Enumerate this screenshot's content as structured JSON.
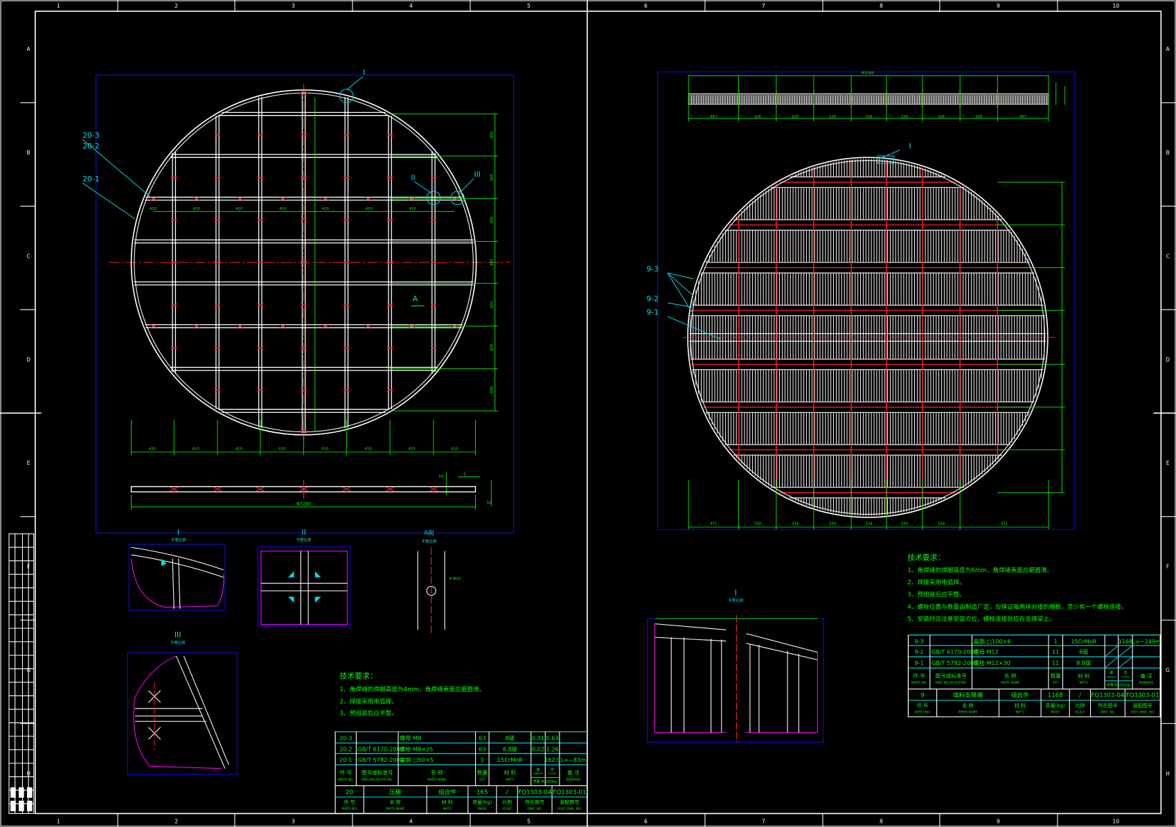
{
  "ruler": {
    "columns": [
      "1",
      "2",
      "3",
      "4",
      "5",
      "6",
      "7",
      "8",
      "9",
      "10"
    ],
    "rows": [
      "A",
      "B",
      "C",
      "D",
      "E",
      "F",
      "G",
      "H"
    ]
  },
  "left_view": {
    "callouts": {
      "I": "I",
      "II": "II",
      "III": "III",
      "p20_3": "20-3",
      "p20_2": "20-2",
      "p20_1": "20-1",
      "arrow_a": "A"
    },
    "dim_horizontal": [
      "410",
      "410",
      "410",
      "410",
      "410",
      "410",
      "410",
      "410"
    ],
    "dim_vertical": [
      "400",
      "400",
      "400",
      "400",
      "400",
      "400",
      "400"
    ],
    "overall_dim": "Φ3280",
    "strip_dims": [
      "5",
      "50",
      "50"
    ],
    "detail_labels": {
      "d1": "I",
      "d2": "II",
      "d3": "A向",
      "d4": "III",
      "scale_note": "不等比例",
      "bolt_note": "4-Φ10"
    }
  },
  "right_view": {
    "callouts": {
      "I": "I",
      "p9_3": "9-3",
      "p9_2": "9-2",
      "p9_1": "9-1"
    },
    "top_dim": "Φ3280",
    "strip_dims": [
      "467",
      "326",
      "326",
      "326",
      "326",
      "326",
      "326",
      "326",
      "467"
    ],
    "bottom_dims": [
      "471",
      "334",
      "334",
      "334",
      "334",
      "334",
      "334",
      "471"
    ],
    "detail_label": "I",
    "scale_note": "不等比例"
  },
  "left_notes": {
    "title": "技术要求：",
    "items": [
      "1、角焊缝的焊脚高度为4mm，角焊缝表面应磨圆滑。",
      "2、焊接采用电弧焊。",
      "3、预组装后应平整。"
    ]
  },
  "right_notes": {
    "title": "技术要求：",
    "items": [
      "1、角焊缝的焊脚高度为6mm，角焊缝表面应磨圆滑。",
      "2、焊接采用电弧焊。",
      "3、预组装后应平整。",
      "4、螺栓位置与数量由制造厂定，应保证每两块对接的栅板，至少有一个螺栓连接。",
      "5、安装时应注意安装方位，螺栓连接处应在支撑梁上。"
    ]
  },
  "left_table": {
    "rows": [
      [
        "20-3",
        "",
        "螺母 M8",
        "63",
        "8级",
        "0.01",
        "0.63",
        ""
      ],
      [
        "20-2",
        "GB/T 6170-2000",
        "螺栓 M8×25",
        "63",
        "8.8级",
        "0.02",
        "1.26",
        ""
      ],
      [
        "20-1",
        "GB/T 5782-2000",
        "扁钢 □50×5",
        "1",
        "15CrMoR",
        "",
        "162.9",
        "L=~83m"
      ]
    ],
    "header": [
      "件 号",
      "图号或标准号",
      "名 称",
      "数量",
      "材 料",
      "单",
      "总",
      "备 注"
    ],
    "header_en": [
      "PARTS NO.",
      "DWG.NO.OR.STD.NO.",
      "PARTS NAME",
      "QTY.",
      "MAT'L",
      "SINGLE",
      "TOTAL",
      "REMARKS"
    ],
    "mass_label": "质量 MASS(kg)",
    "assembly": [
      "20",
      "压栅",
      "组合件",
      "165",
      "/",
      "FQ1303-04",
      "FQ1303-01"
    ],
    "assembly_header": [
      "件 号",
      "名 称",
      "材 料",
      "质量(kg)",
      "比例",
      "所在图号",
      "装配图号"
    ],
    "assembly_header_en": [
      "PARTS NO.",
      "PARTS NAME",
      "MAT'L",
      "MASS",
      "SCALE",
      "DWG. NO.",
      "ASSY. DWG. NO."
    ]
  },
  "right_table": {
    "rows": [
      [
        "9-3",
        "",
        "扁钢 □100×6",
        "1",
        "15CrMoR",
        "",
        "1168",
        "L=~249m"
      ],
      [
        "9-2",
        "GB/T 6170-2000",
        "螺母 M12",
        "11",
        "8级",
        "",
        "",
        ""
      ],
      [
        "9-1",
        "GB/T 5782-2000",
        "螺栓 M12×30",
        "11",
        "8.8级",
        "",
        "",
        ""
      ]
    ],
    "header": [
      "件 号",
      "图号或标准号",
      "名 称",
      "数量",
      "材 料",
      "单",
      "总",
      "备 注"
    ],
    "header_en": [
      "PARTS NO.",
      "DWG.NO.OR.STD.NO.",
      "PARTS NAME",
      "QTY.",
      "MAT'L",
      "SINGLE",
      "TOTAL",
      "REMARKS"
    ],
    "mass_label": "质量 MASS(kg)",
    "assembly": [
      "9",
      "填料支撑栅",
      "组合件",
      "1168",
      "/",
      "FQ1303-04",
      "FQ1303-01"
    ],
    "assembly_header": [
      "件 号",
      "名 称",
      "材 料",
      "质量(kg)",
      "比例",
      "所在图号",
      "装配图号"
    ],
    "assembly_header_en": [
      "PARTS NO.",
      "PARTS NAME",
      "MAT'L",
      "MASS",
      "SCALE",
      "DWG. NO.",
      "ASSY. DWG. NO."
    ]
  },
  "colors": {
    "bg": "#000000",
    "line": "#ffffff",
    "dim": "#00ff00",
    "table": "#00c8d0",
    "frame": "#1010d0",
    "center": "#ff2020",
    "detail": "#ff00ff"
  }
}
